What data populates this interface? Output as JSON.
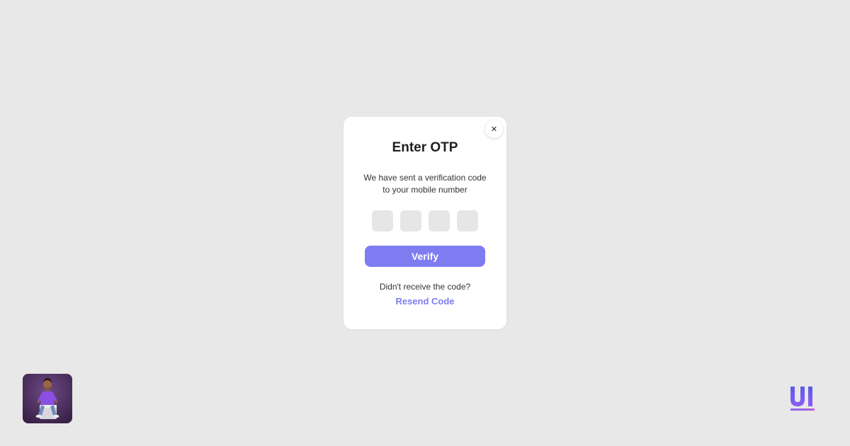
{
  "modal": {
    "close_glyph": "✕",
    "title": "Enter OTP",
    "subtitle": "We have sent a verification code to your mobile number",
    "otp_digits": [
      "",
      "",
      "",
      ""
    ],
    "verify_label": "Verify",
    "didnt_receive": "Didn't receive the code?",
    "resend_label": "Resend Code"
  },
  "colors": {
    "background": "#e8e8e8",
    "accent": "#7f7cf2",
    "card": "#ffffff",
    "input_fill": "#e6e6e6"
  },
  "icons": {
    "close": "close-icon",
    "avatar": "user-avatar",
    "logo": "ui-logo"
  }
}
